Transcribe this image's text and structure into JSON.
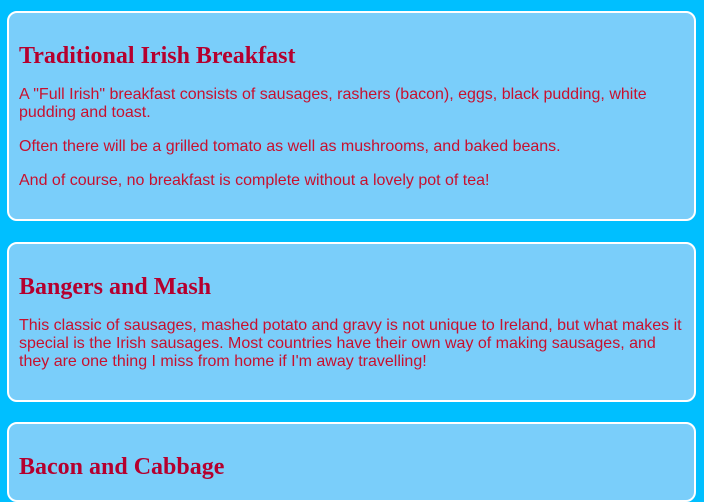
{
  "sections": [
    {
      "title": "Traditional Irish Breakfast",
      "paragraphs": [
        "A \"Full Irish\" breakfast consists of sausages, rashers (bacon), eggs, black pudding, white pudding and toast.",
        "Often there will be a grilled tomato as well as mushrooms, and baked beans.",
        "And of course, no breakfast is complete without a lovely pot of tea!"
      ]
    },
    {
      "title": "Bangers and Mash",
      "paragraphs": [
        "This classic of sausages, mashed potato and gravy is not unique to Ireland, but what makes it special is the Irish sausages. Most countries have their own way of making sausages, and they are one thing I miss from home if I'm away travelling!"
      ]
    },
    {
      "title": "Bacon and Cabbage",
      "paragraphs": []
    }
  ],
  "colors": {
    "page_background": "#00BFFF",
    "card_background": "#7ACEFA",
    "card_border": "#FFFFFF",
    "heading_text": "#B5002E",
    "body_text": "#C8102E"
  }
}
